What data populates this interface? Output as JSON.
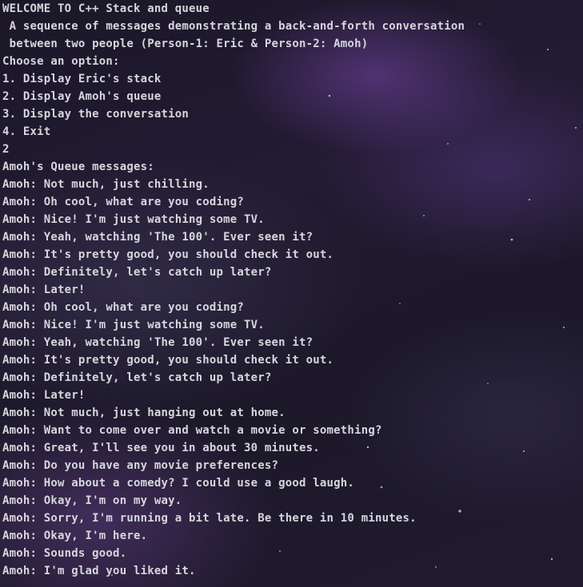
{
  "terminal": {
    "header": [
      "WELCOME TO C++ Stack and queue",
      " A sequence of messages demonstrating a back-and-forth conversation",
      " between two people (Person-1: Eric & Person-2: Amoh)"
    ],
    "menu_prompt": "Choose an option:",
    "menu_options": [
      "1. Display Eric's stack",
      "2. Display Amoh's queue",
      "3. Display the conversation",
      "4. Exit"
    ],
    "user_input": "2",
    "queue_heading": "Amoh's Queue messages:",
    "queue_messages": [
      "Amoh: Not much, just chilling.",
      "Amoh: Oh cool, what are you coding?",
      "Amoh: Nice! I'm just watching some TV.",
      "Amoh: Yeah, watching 'The 100'. Ever seen it?",
      "Amoh: It's pretty good, you should check it out.",
      "Amoh: Definitely, let's catch up later?",
      "Amoh: Later!",
      "Amoh: Oh cool, what are you coding?",
      "Amoh: Nice! I'm just watching some TV.",
      "Amoh: Yeah, watching 'The 100'. Ever seen it?",
      "Amoh: It's pretty good, you should check it out.",
      "Amoh: Definitely, let's catch up later?",
      "Amoh: Later!",
      "Amoh: Not much, just hanging out at home.",
      "Amoh: Want to come over and watch a movie or something?",
      "Amoh: Great, I'll see you in about 30 minutes.",
      "Amoh: Do you have any movie preferences?",
      "Amoh: How about a comedy? I could use a good laugh.",
      "Amoh: Okay, I'm on my way.",
      "Amoh: Sorry, I'm running a bit late. Be there in 10 minutes.",
      "Amoh: Okay, I'm here.",
      "Amoh: Sounds good.",
      "Amoh: I'm glad you liked it."
    ],
    "colors": {
      "text": "#d6d6dc",
      "background": "#1e1a2c",
      "nebula": "#7a4aa8"
    }
  }
}
